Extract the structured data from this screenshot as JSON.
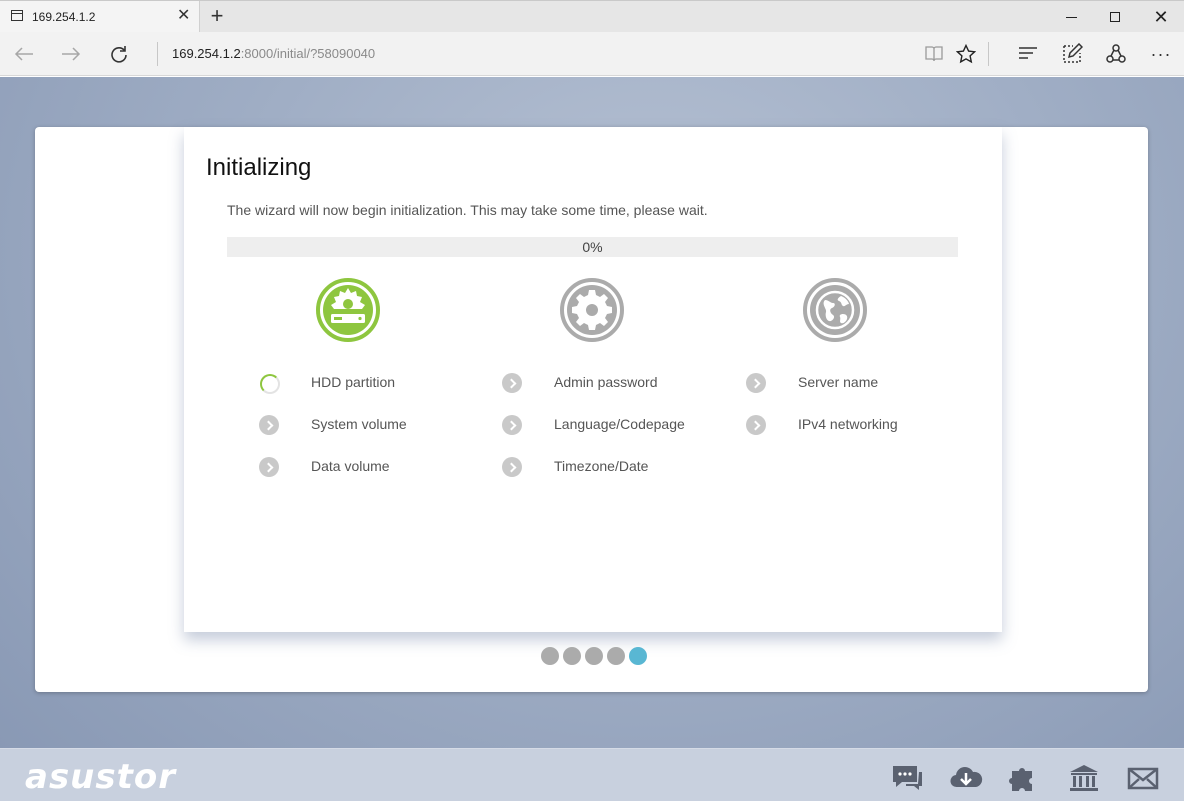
{
  "browser": {
    "tab_title": "169.254.1.2",
    "address_host": "169.254.1.2",
    "address_path": ":8000/initial/?58090040",
    "new_tab_glyph": "+",
    "close_glyph": "✕",
    "more_glyph": "···"
  },
  "wizard": {
    "title": "Initializing",
    "subtitle": "The wizard will now begin initialization. This may take some time, please wait.",
    "progress_text": "0%",
    "progress_value": 0,
    "columns": [
      {
        "icon": "hdd-gear-icon",
        "status": "active",
        "tasks": [
          {
            "label": "HDD partition",
            "state": "loading"
          },
          {
            "label": "System volume",
            "state": "pending"
          },
          {
            "label": "Data volume",
            "state": "pending"
          }
        ]
      },
      {
        "icon": "gear-icon",
        "status": "pending",
        "tasks": [
          {
            "label": "Admin password",
            "state": "pending"
          },
          {
            "label": "Language/Codepage",
            "state": "pending"
          },
          {
            "label": "Timezone/Date",
            "state": "pending"
          }
        ]
      },
      {
        "icon": "globe-icon",
        "status": "pending",
        "tasks": [
          {
            "label": "Server name",
            "state": "pending"
          },
          {
            "label": "IPv4 networking",
            "state": "pending"
          }
        ]
      }
    ],
    "pager": {
      "total": 5,
      "current": 5
    }
  },
  "footer": {
    "logo": "asustor",
    "icons": [
      "chat-icon",
      "cloud-download-icon",
      "puzzle-icon",
      "bank-icon",
      "mail-icon"
    ]
  },
  "colors": {
    "accent_green": "#8ec63f",
    "inactive_gray": "#ababab",
    "pager_active": "#59b7d3"
  }
}
